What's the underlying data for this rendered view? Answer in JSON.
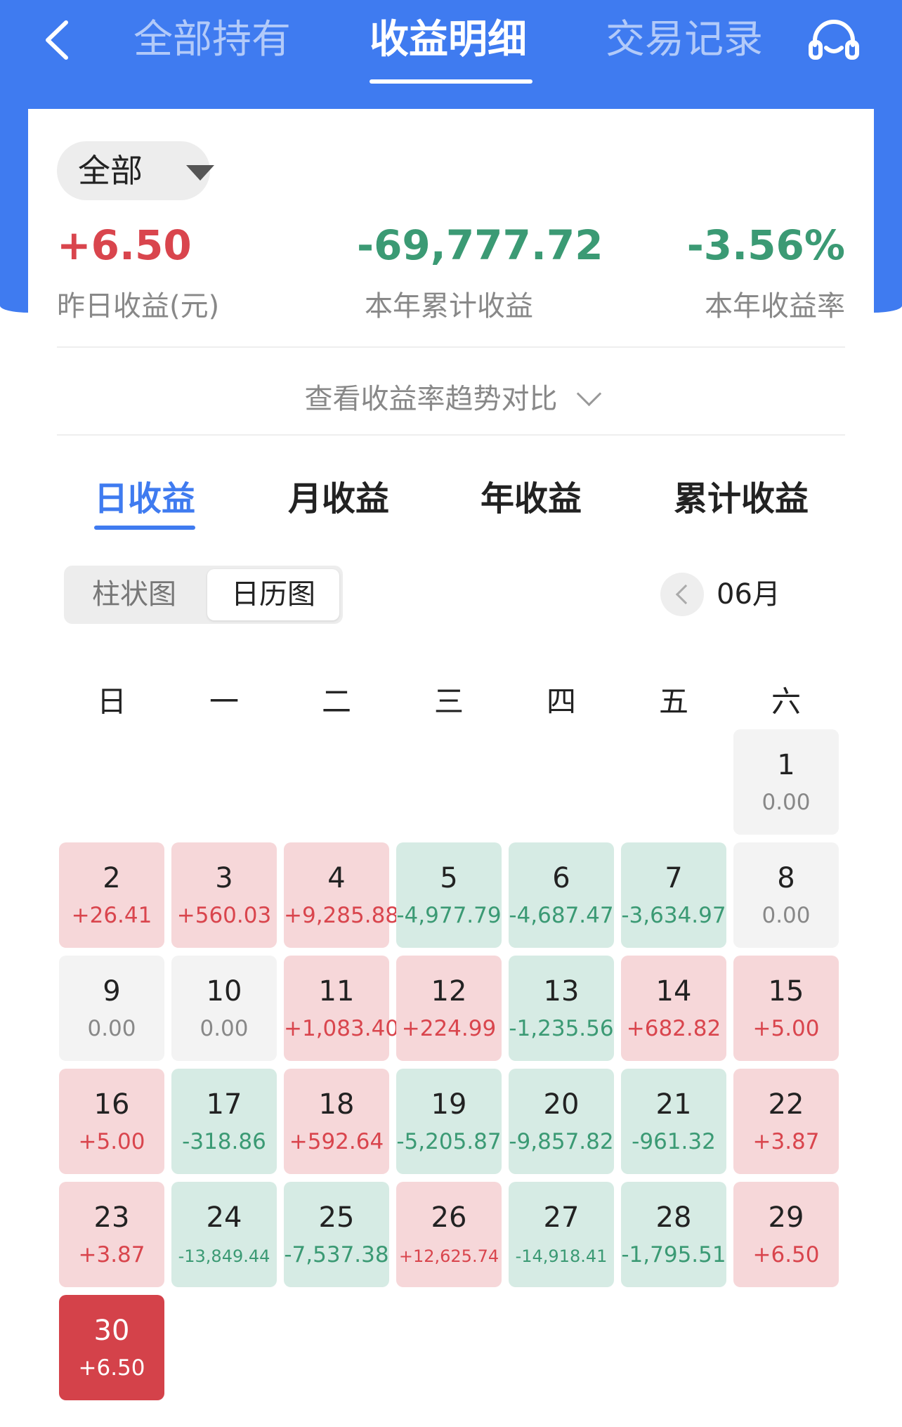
{
  "nav": {
    "tabs": [
      "全部持有",
      "收益明细",
      "交易记录"
    ],
    "active_tab": 1
  },
  "filter": {
    "selected": "全部"
  },
  "stats": [
    {
      "value": "+6.50",
      "label": "昨日收益(元)",
      "tone": "red"
    },
    {
      "value": "-69,777.72",
      "label": "本年累计收益",
      "tone": "green"
    },
    {
      "value": "-3.56%",
      "label": "本年收益率",
      "tone": "green"
    }
  ],
  "trend_link": "查看收益率趋势对比",
  "sub_tabs": [
    "日收益",
    "月收益",
    "年收益",
    "累计收益"
  ],
  "view_toggle": {
    "bar": "柱状图",
    "calendar": "日历图"
  },
  "month_label": "06月",
  "weekdays": [
    "日",
    "一",
    "二",
    "三",
    "四",
    "五",
    "六"
  ],
  "days": [
    {
      "d": "1",
      "v": "0.00",
      "t": "zero"
    },
    {
      "d": "2",
      "v": "+26.41",
      "t": "pos"
    },
    {
      "d": "3",
      "v": "+560.03",
      "t": "pos"
    },
    {
      "d": "4",
      "v": "+9,285.88",
      "t": "pos"
    },
    {
      "d": "5",
      "v": "-4,977.79",
      "t": "neg"
    },
    {
      "d": "6",
      "v": "-4,687.47",
      "t": "neg"
    },
    {
      "d": "7",
      "v": "-3,634.97",
      "t": "neg"
    },
    {
      "d": "8",
      "v": "0.00",
      "t": "zero"
    },
    {
      "d": "9",
      "v": "0.00",
      "t": "zero"
    },
    {
      "d": "10",
      "v": "0.00",
      "t": "zero"
    },
    {
      "d": "11",
      "v": "+1,083.40",
      "t": "pos"
    },
    {
      "d": "12",
      "v": "+224.99",
      "t": "pos"
    },
    {
      "d": "13",
      "v": "-1,235.56",
      "t": "neg"
    },
    {
      "d": "14",
      "v": "+682.82",
      "t": "pos"
    },
    {
      "d": "15",
      "v": "+5.00",
      "t": "pos"
    },
    {
      "d": "16",
      "v": "+5.00",
      "t": "pos"
    },
    {
      "d": "17",
      "v": "-318.86",
      "t": "neg"
    },
    {
      "d": "18",
      "v": "+592.64",
      "t": "pos"
    },
    {
      "d": "19",
      "v": "-5,205.87",
      "t": "neg"
    },
    {
      "d": "20",
      "v": "-9,857.82",
      "t": "neg"
    },
    {
      "d": "21",
      "v": "-961.32",
      "t": "neg"
    },
    {
      "d": "22",
      "v": "+3.87",
      "t": "pos"
    },
    {
      "d": "23",
      "v": "+3.87",
      "t": "pos"
    },
    {
      "d": "24",
      "v": "-13,849.44",
      "t": "neg"
    },
    {
      "d": "25",
      "v": "-7,537.38",
      "t": "neg"
    },
    {
      "d": "26",
      "v": "+12,625.74",
      "t": "pos"
    },
    {
      "d": "27",
      "v": "-14,918.41",
      "t": "neg"
    },
    {
      "d": "28",
      "v": "-1,795.51",
      "t": "neg"
    },
    {
      "d": "29",
      "v": "+6.50",
      "t": "pos"
    },
    {
      "d": "30",
      "v": "+6.50",
      "t": "sel"
    }
  ],
  "first_weekday": 6
}
